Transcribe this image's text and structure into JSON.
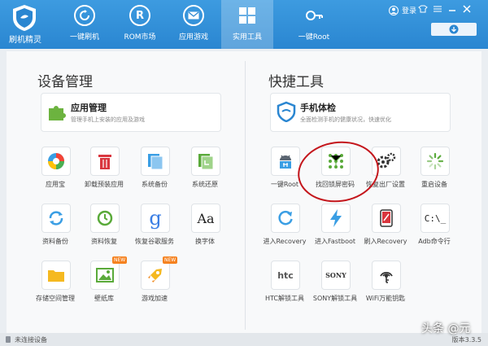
{
  "app": {
    "title": "刷机精灵"
  },
  "nav": [
    {
      "label": "一键刷机",
      "icon": "restart-icon"
    },
    {
      "label": "ROM市场",
      "icon": "rom-icon",
      "glyph": "R"
    },
    {
      "label": "应用游戏",
      "icon": "mail-icon"
    },
    {
      "label": "实用工具",
      "icon": "grid-icon"
    },
    {
      "label": "一键Root",
      "icon": "key-icon"
    }
  ],
  "header": {
    "login": "登录"
  },
  "left": {
    "title": "设备管理",
    "card": {
      "title": "应用管理",
      "subtitle": "管理手机上安装的应用及游戏"
    },
    "tiles": [
      {
        "label": "应用宝"
      },
      {
        "label": "卸载预装应用"
      },
      {
        "label": "系统备份"
      },
      {
        "label": "系统还原"
      },
      {
        "label": "资料备份"
      },
      {
        "label": "资料恢复"
      },
      {
        "label": "恢复谷歌服务",
        "glyph": "g"
      },
      {
        "label": "换字体",
        "glyph": "Aa"
      },
      {
        "label": "存储空间管理"
      },
      {
        "label": "壁纸库",
        "badge": "NEW"
      },
      {
        "label": "游戏加速",
        "badge": "NEW"
      }
    ]
  },
  "right": {
    "title": "快捷工具",
    "card": {
      "title": "手机体检",
      "subtitle": "全面检测手机的健康状况，快速优化"
    },
    "tiles": [
      {
        "label": "一键Root"
      },
      {
        "label": "找回锁屏密码"
      },
      {
        "label": "恢复出厂设置"
      },
      {
        "label": "重启设备"
      },
      {
        "label": "进入Recovery"
      },
      {
        "label": "进入Fastboot"
      },
      {
        "label": "刷入Recovery"
      },
      {
        "label": "Adb命令行",
        "glyph": "C:\\_"
      },
      {
        "label": "HTC解锁工具",
        "glyph": "htc"
      },
      {
        "label": "SONY解锁工具",
        "glyph": "SONY"
      },
      {
        "label": "WiFi万能钥匙"
      }
    ]
  },
  "status": {
    "text": "未连接设备",
    "version": "版本3.3.5"
  },
  "watermark": "头条 @元",
  "colors": {
    "accent": "#2a86d1",
    "topbar": "#3d9be0",
    "annotation": "#c4161c"
  }
}
